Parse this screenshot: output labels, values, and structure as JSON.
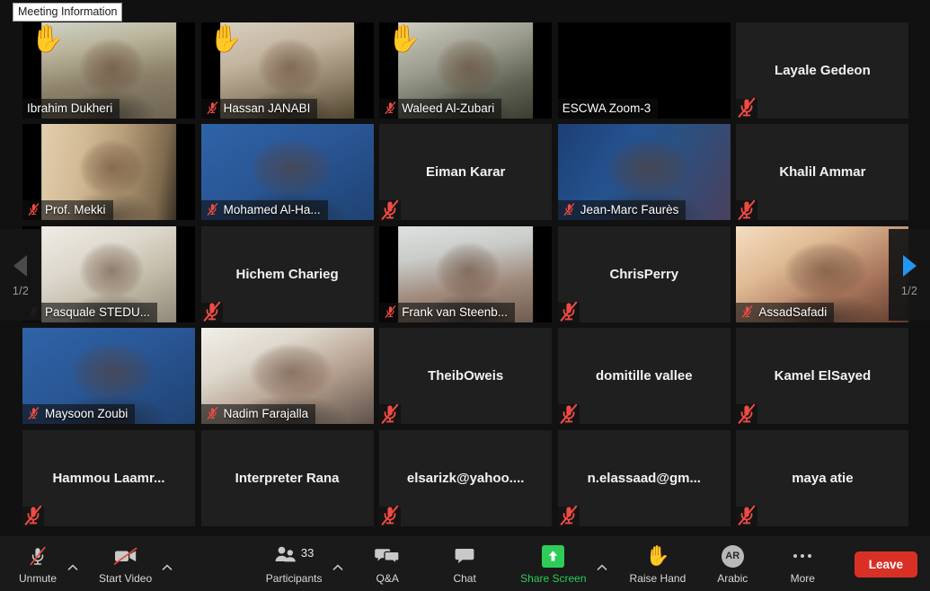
{
  "tooltip": {
    "label": "Meeting Information"
  },
  "gallery": {
    "columns": 5,
    "rows": 5,
    "pager": {
      "left": {
        "icon": "triangle-left-icon",
        "page": "1/2"
      },
      "right": {
        "icon": "triangle-right-icon",
        "page": "1/2"
      }
    },
    "active_speaker_color": "#e7ef55",
    "participants": [
      {
        "name": "Ibrahim Dukheri",
        "video": true,
        "muted": false,
        "hand": true,
        "active": true,
        "bg": "office-beige"
      },
      {
        "name": "Hassan JANABI",
        "video": true,
        "muted": true,
        "hand": true,
        "active": false,
        "bg": "room-paintings"
      },
      {
        "name": "Waleed Al-Zubari",
        "video": true,
        "muted": true,
        "hand": true,
        "active": false,
        "bg": "room-plant"
      },
      {
        "name": "ESCWA Zoom-3",
        "video": true,
        "muted": false,
        "hand": false,
        "active": false,
        "bg": "conference-room"
      },
      {
        "name": "Layale Gedeon",
        "video": false,
        "muted": true,
        "hand": false,
        "active": false,
        "bg": "none"
      },
      {
        "name": "Prof. Mekki",
        "video": true,
        "muted": true,
        "hand": false,
        "active": false,
        "bg": "curtain"
      },
      {
        "name": "Mohamed Al-Ha...",
        "video": true,
        "muted": true,
        "hand": false,
        "active": false,
        "bg": "fao-blue"
      },
      {
        "name": "Eiman Karar",
        "video": false,
        "muted": true,
        "hand": false,
        "active": false,
        "bg": "none"
      },
      {
        "name": "Jean-Marc Faurès",
        "video": true,
        "muted": true,
        "hand": false,
        "active": false,
        "bg": "fao-sdg-blue"
      },
      {
        "name": "Khalil Ammar",
        "video": false,
        "muted": true,
        "hand": false,
        "active": false,
        "bg": "none"
      },
      {
        "name": "Pasquale STEDU...",
        "video": true,
        "muted": true,
        "hand": false,
        "active": false,
        "bg": "bookshelf"
      },
      {
        "name": "Hichem Charieg",
        "video": false,
        "muted": true,
        "hand": false,
        "active": false,
        "bg": "none"
      },
      {
        "name": "Frank van Steenb...",
        "video": true,
        "muted": true,
        "hand": false,
        "active": false,
        "bg": "ceiling-office"
      },
      {
        "name": "ChrisPerry",
        "video": false,
        "muted": true,
        "hand": false,
        "active": false,
        "bg": "none"
      },
      {
        "name": "AssadSafadi",
        "video": true,
        "muted": true,
        "hand": false,
        "active": false,
        "bg": "warm-room"
      },
      {
        "name": "Maysoon Zoubi",
        "video": true,
        "muted": true,
        "hand": false,
        "active": false,
        "bg": "fao-blue"
      },
      {
        "name": "Nadim Farajalla",
        "video": true,
        "muted": true,
        "hand": false,
        "active": false,
        "bg": "bright-room"
      },
      {
        "name": "TheibOweis",
        "video": false,
        "muted": true,
        "hand": false,
        "active": false,
        "bg": "none"
      },
      {
        "name": "domitille vallee",
        "video": false,
        "muted": true,
        "hand": false,
        "active": false,
        "bg": "none"
      },
      {
        "name": "Kamel ElSayed",
        "video": false,
        "muted": true,
        "hand": false,
        "active": false,
        "bg": "none"
      },
      {
        "name": "Hammou  Laamr...",
        "video": false,
        "muted": true,
        "hand": false,
        "active": false,
        "bg": "none"
      },
      {
        "name": "Interpreter Rana",
        "video": false,
        "muted": false,
        "hand": false,
        "active": false,
        "bg": "none"
      },
      {
        "name": "elsarizk@yahoo....",
        "video": false,
        "muted": true,
        "hand": false,
        "active": false,
        "bg": "none"
      },
      {
        "name": "n.elassaad@gm...",
        "video": false,
        "muted": true,
        "hand": false,
        "active": false,
        "bg": "none"
      },
      {
        "name": "maya atie",
        "video": false,
        "muted": true,
        "hand": false,
        "active": false,
        "bg": "none"
      }
    ]
  },
  "toolbar": {
    "mute": {
      "label": "Unmute",
      "icon": "microphone-muted-icon",
      "caret": "chevron-up-icon"
    },
    "video": {
      "label": "Start Video",
      "icon": "camera-off-icon",
      "caret": "chevron-up-icon"
    },
    "participants": {
      "label": "Participants",
      "icon": "people-icon",
      "count": "33",
      "caret": "chevron-up-icon"
    },
    "qa": {
      "label": "Q&A",
      "icon": "speech-bubbles-icon"
    },
    "chat": {
      "label": "Chat",
      "icon": "chat-bubble-icon"
    },
    "share": {
      "label": "Share Screen",
      "icon": "share-screen-up-arrow-icon",
      "caret": "chevron-up-icon",
      "color": "#2ecc58"
    },
    "raise_hand": {
      "label": "Raise Hand",
      "icon": "raised-hand-icon"
    },
    "language": {
      "label": "Arabic",
      "icon": "interpretation-avatar-icon",
      "initials": "AR"
    },
    "more": {
      "label": "More",
      "icon": "ellipsis-icon"
    },
    "leave": {
      "label": "Leave",
      "color": "#d93025"
    }
  }
}
